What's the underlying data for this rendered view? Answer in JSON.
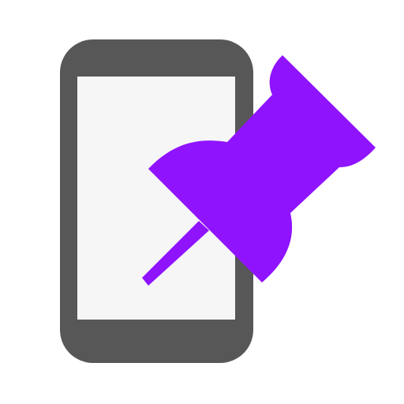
{
  "icon": {
    "phone_icon": "phone-icon",
    "pin_icon": "pushpin-icon"
  },
  "colors": {
    "background": "#ffffff",
    "phone_body": "#575757",
    "phone_screen": "#f6f6f6",
    "pin": "#9013fe"
  }
}
